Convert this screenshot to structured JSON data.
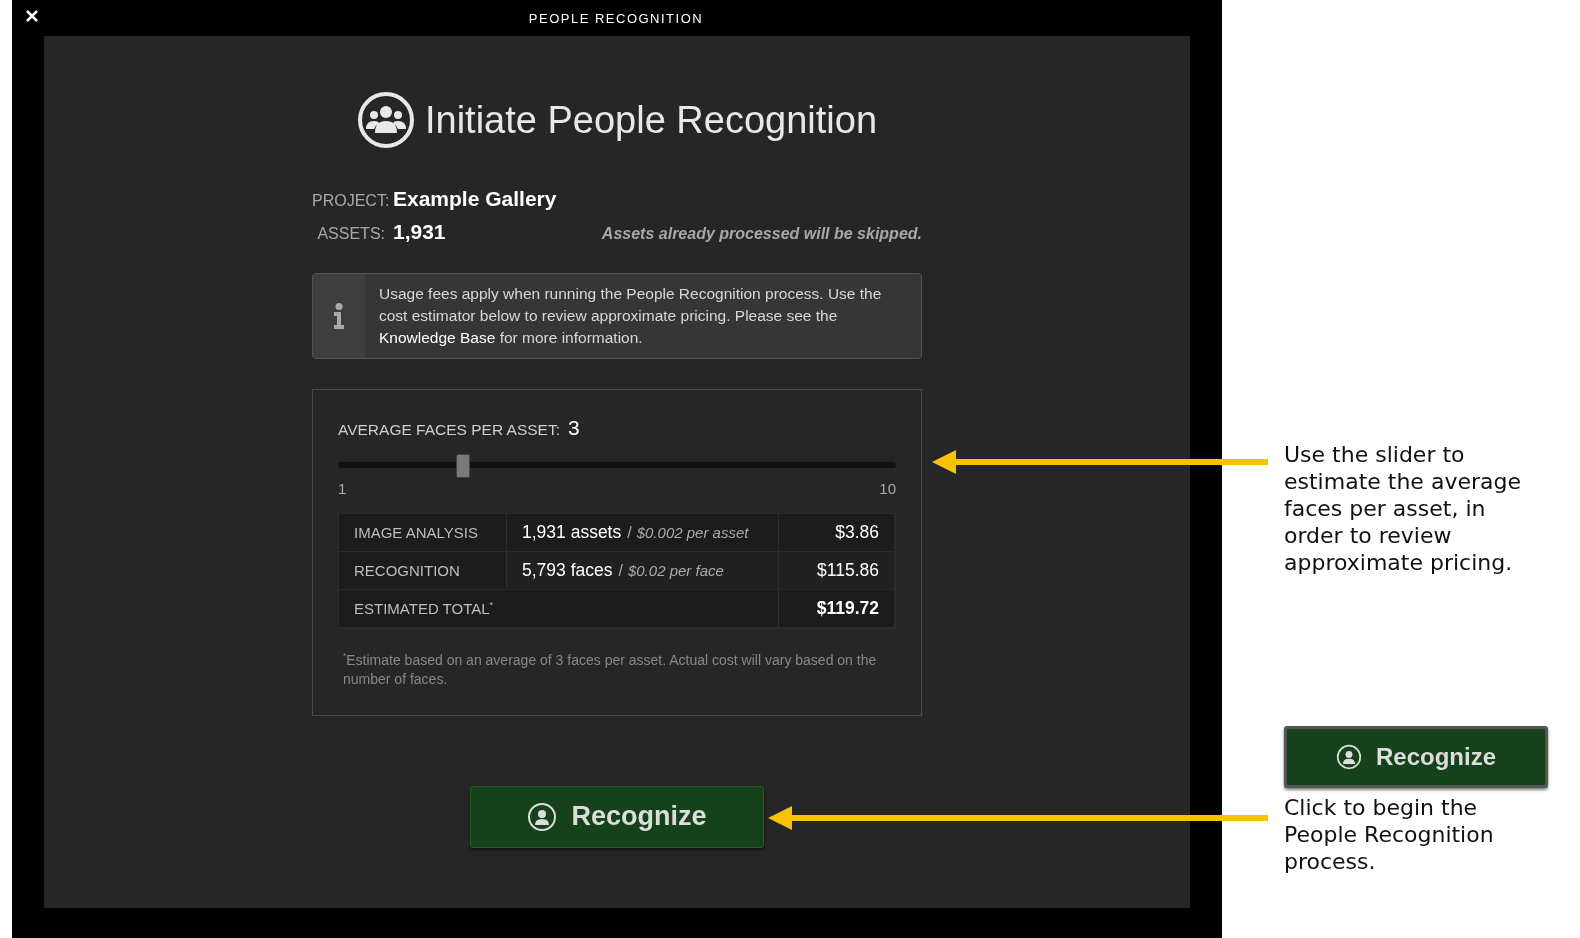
{
  "window": {
    "title": "PEOPLE RECOGNITION"
  },
  "heading": {
    "title": "Initiate People Recognition"
  },
  "project": {
    "label": "PROJECT:",
    "value": "Example Gallery"
  },
  "assets": {
    "label": "ASSETS:",
    "value": "1,931"
  },
  "skip_note": "Assets already processed will be skipped.",
  "info": {
    "text_before": "Usage fees apply when running the People Recognition process. Use the cost estimator below to review approximate pricing. Please see the",
    "link": "Knowledge Base",
    "text_after": "for more information."
  },
  "estimator": {
    "label": "AVERAGE FACES PER ASSET:",
    "value": "3",
    "slider": {
      "level": 0.222,
      "min_label": "1",
      "max_label": "10"
    },
    "rows": [
      {
        "kind": "line",
        "name": "IMAGE ANALYSIS",
        "quantity": "1,931 assets",
        "separator": "/",
        "rate": "$0.002 per asset",
        "cost": "$3.86"
      },
      {
        "kind": "line",
        "name": "RECOGNITION",
        "quantity": "5,793 faces",
        "separator": "/",
        "rate": "$0.02 per face",
        "cost": "$115.86"
      },
      {
        "kind": "total",
        "name": "ESTIMATED TOTAL$^{*}$",
        "cost": "$119.72"
      }
    ],
    "footnote": "$^{*}$Estimate based on an average of 3 faces per asset. Actual cost will vary based on the number of faces."
  },
  "recognize_button": {
    "label": "Recognize"
  },
  "annotations": [
    {
      "kind": "text",
      "text": "Use the slider to estimate the average faces per asset, in order to review approximate pricing."
    },
    {
      "kind": "button",
      "label": "Recognize"
    },
    {
      "kind": "text",
      "text": "Click to begin the People Recognition process."
    }
  ]
}
